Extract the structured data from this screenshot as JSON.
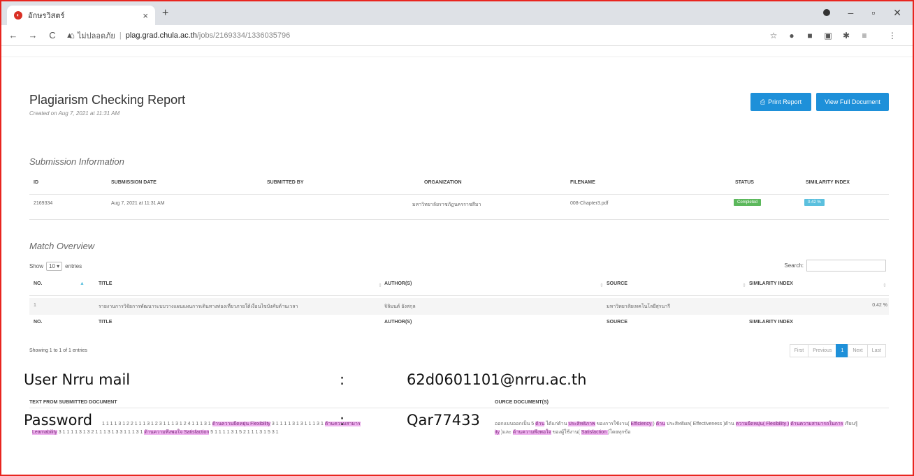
{
  "browser": {
    "tab_title": "อักษรวิสตร์",
    "tab_close": "×",
    "new_tab": "+",
    "url_warning": "ไม่ปลอดภัย",
    "url_host": "plag.grad.chula.ac.th",
    "url_path": "/jobs/2169334/1336035796"
  },
  "report": {
    "title": "Plagiarism Checking Report",
    "created": "Created on Aug 7, 2021 at 11:31 AM",
    "print_label": "Print Report",
    "full_label": "View Full Document"
  },
  "submission": {
    "title": "Submission Information",
    "headers": [
      "ID",
      "SUBMISSION DATE",
      "SUBMITTED BY",
      "ORGANIZATION",
      "FILENAME",
      "STATUS",
      "SIMILARITY INDEX"
    ],
    "row": {
      "id": "2169334",
      "date": "Aug 7, 2021 at 11:31 AM",
      "submitted_by": "",
      "organization": "มหาวิทยาลัยราชภัฏนครราชสีมา",
      "filename": "008-Chapter3.pdf",
      "status": "Completed",
      "similarity": "0.42 %"
    },
    "status_color": "#5cb85c",
    "similarity_color": "#5bc0de"
  },
  "match_overview": {
    "title": "Match Overview",
    "show": "Show",
    "entries_value": "10",
    "entries": "entries",
    "search_label": "Search:",
    "headers": [
      "NO.",
      "TITLE",
      "AUTHOR(S)",
      "SOURCE",
      "SIMILARITY INDEX"
    ],
    "rows": [
      {
        "no": "1",
        "title": "รายงานการวิจัยการพัฒนาระบบวางแผนแผนการเดินทางท่องเที่ยวภายใต้เงื่อนไขบังคับด้านเวลา",
        "author": "จิลิมนต์ อังสกุล",
        "source": "มหาวิทยาลัยเทคโนโลยีสุรนารี",
        "similarity": "0.42 %"
      }
    ],
    "showing": "Showing 1 to 1 of 1 entries",
    "pager": [
      "First",
      "Previous",
      "1",
      "Next",
      "Last"
    ]
  },
  "match_details": {
    "left_header": "TEXT FROM SUBMITTED DOCUMENT",
    "right_header": "OURCE DOCUMENT(S)",
    "left_line1_plain": "1 1 1 1 3 1 2 2 1 1 1 3 1 2 3 1 1 1 3 1 2 4 1 1 1 3 1",
    "left_line1_hl1": "ด้านความยืดหยุ่น Flexibility",
    "left_line1_mid": "3 1 1 1 1 3 1 3",
    "left_line1_end": "1 1 1 3 1",
    "left_line1_hl2": "ด้านความสามาร",
    "left_line2_hl1": "Learnability",
    "left_line2_plain": "3 1 1 1 1 3 1 3 2 1 1 1 3 1 3 3 1 1 1 3 1",
    "left_line2_hl2": "ด้านความพึงพอใจ Satisfaction",
    "left_line2_end": "5 1 1 1 1 3 1 5 2 1 1 1 3 1 5 3 1",
    "right_line1_a": "ออกแบบออกเป็น 5",
    "right_line1_hl1": "ด้าน",
    "right_line1_b": "ได้แก่ด้าน",
    "right_line1_hl2": "ประสิทธิภาพ",
    "right_line1_c": "ของการใช้งาน(",
    "right_line1_hl3": " Efficiency ",
    "right_line1_d": ")",
    "right_line1_hl4": "ด้าน",
    "right_line1_e": "ประสิทธิผล( Effectiveness )ด้าน",
    "right_line1_hl5": "ความยืดหยุ่น( Flexibility )",
    "right_line1_hl6": "ด้านความสามารถในการ",
    "right_line1_f": "เรียนรู้",
    "right_line2_hl1": "ity",
    "right_line2_a": ")และ",
    "right_line2_hl2": "ด้านความพึงพอใจ",
    "right_line2_b": "ของผู้ใช้งาน(",
    "right_line2_hl3": " Satisfaction ",
    "right_line2_c": ")โดยทุกข้อ"
  },
  "overlay": {
    "user_label": "User Nrru mail",
    "user_colon": ":",
    "user_value": "62d0601101@nrru.ac.th",
    "pass_label": "Password",
    "pass_colon": ":",
    "pass_value": "Qar77433"
  }
}
